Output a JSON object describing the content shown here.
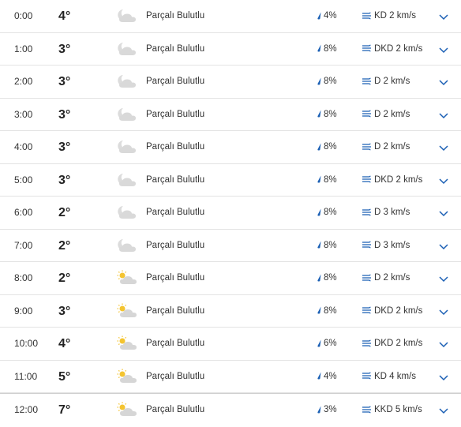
{
  "colors": {
    "accent": "#1a5fb4",
    "divider": "#e3e3e3"
  },
  "rows": [
    {
      "time": "0:00",
      "temp": "4°",
      "icon": "partly-cloudy-night-icon",
      "condition": "Parçalı Bulutlu",
      "precip": "4%",
      "wind": "KD 2 km/s"
    },
    {
      "time": "1:00",
      "temp": "3°",
      "icon": "partly-cloudy-night-icon",
      "condition": "Parçalı Bulutlu",
      "precip": "8%",
      "wind": "DKD 2 km/s"
    },
    {
      "time": "2:00",
      "temp": "3°",
      "icon": "partly-cloudy-night-icon",
      "condition": "Parçalı Bulutlu",
      "precip": "8%",
      "wind": "D 2 km/s"
    },
    {
      "time": "3:00",
      "temp": "3°",
      "icon": "partly-cloudy-night-icon",
      "condition": "Parçalı Bulutlu",
      "precip": "8%",
      "wind": "D 2 km/s"
    },
    {
      "time": "4:00",
      "temp": "3°",
      "icon": "partly-cloudy-night-icon",
      "condition": "Parçalı Bulutlu",
      "precip": "8%",
      "wind": "D 2 km/s"
    },
    {
      "time": "5:00",
      "temp": "3°",
      "icon": "partly-cloudy-night-icon",
      "condition": "Parçalı Bulutlu",
      "precip": "8%",
      "wind": "DKD 2 km/s"
    },
    {
      "time": "6:00",
      "temp": "2°",
      "icon": "partly-cloudy-night-icon",
      "condition": "Parçalı Bulutlu",
      "precip": "8%",
      "wind": "D 3 km/s"
    },
    {
      "time": "7:00",
      "temp": "2°",
      "icon": "partly-cloudy-night-icon",
      "condition": "Parçalı Bulutlu",
      "precip": "8%",
      "wind": "D 3 km/s"
    },
    {
      "time": "8:00",
      "temp": "2°",
      "icon": "partly-cloudy-day-icon",
      "condition": "Parçalı Bulutlu",
      "precip": "8%",
      "wind": "D 2 km/s"
    },
    {
      "time": "9:00",
      "temp": "3°",
      "icon": "partly-cloudy-day-icon",
      "condition": "Parçalı Bulutlu",
      "precip": "8%",
      "wind": "DKD 2 km/s"
    },
    {
      "time": "10:00",
      "temp": "4°",
      "icon": "partly-cloudy-day-icon",
      "condition": "Parçalı Bulutlu",
      "precip": "6%",
      "wind": "DKD 2 km/s"
    },
    {
      "time": "11:00",
      "temp": "5°",
      "icon": "partly-cloudy-day-icon",
      "condition": "Parçalı Bulutlu",
      "precip": "4%",
      "wind": "KD 4 km/s"
    },
    {
      "time": "12:00",
      "temp": "7°",
      "icon": "partly-cloudy-day-icon",
      "condition": "Parçalı Bulutlu",
      "precip": "3%",
      "wind": "KKD 5 km/s"
    }
  ]
}
